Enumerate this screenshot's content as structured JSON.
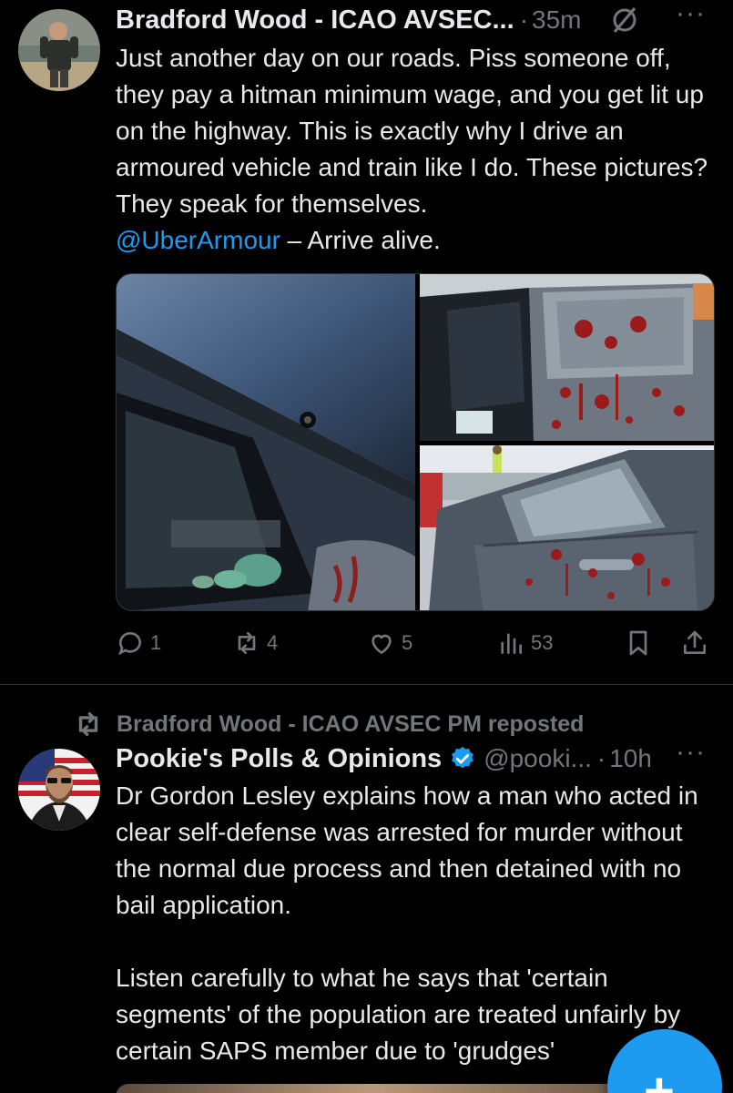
{
  "post1": {
    "author_name": "Bradford Wood - ICAO AVSEC...",
    "dot": "·",
    "time": "35m",
    "more": "···",
    "text_main": "Just another day on our roads. Piss someone off, they pay a hitman minimum wage, and you get lit up on the highway. This is exactly why I drive an armoured vehicle and train like I do. These pictures? They speak for themselves.\n",
    "mention": "@UberArmour",
    "text_tail": " – Arrive alive.",
    "icons": [
      "grok-icon",
      "more-icon"
    ],
    "actions": {
      "replies": "1",
      "reposts": "4",
      "likes": "5",
      "views": "53"
    }
  },
  "post2": {
    "repost_label": "Bradford Wood - ICAO AVSEC PM reposted",
    "author_name": "Pookie's Polls & Opinions",
    "handle": "@pooki...",
    "dot": "·",
    "time": "10h",
    "more": "···",
    "text": "Dr Gordon Lesley explains how a man who acted in clear self-defense was arrested for murder without the normal due process and then detained with no bail application.\n\nListen carefully to what he says that 'certain segments' of the population are treated unfairly by certain SAPS member due to 'grudges'"
  },
  "fab": {
    "label": "+"
  },
  "colors": {
    "background": "#000000",
    "text": "#e7e9ea",
    "muted": "#71767b",
    "accent": "#1d9bf0",
    "divider": "#2f3336"
  }
}
